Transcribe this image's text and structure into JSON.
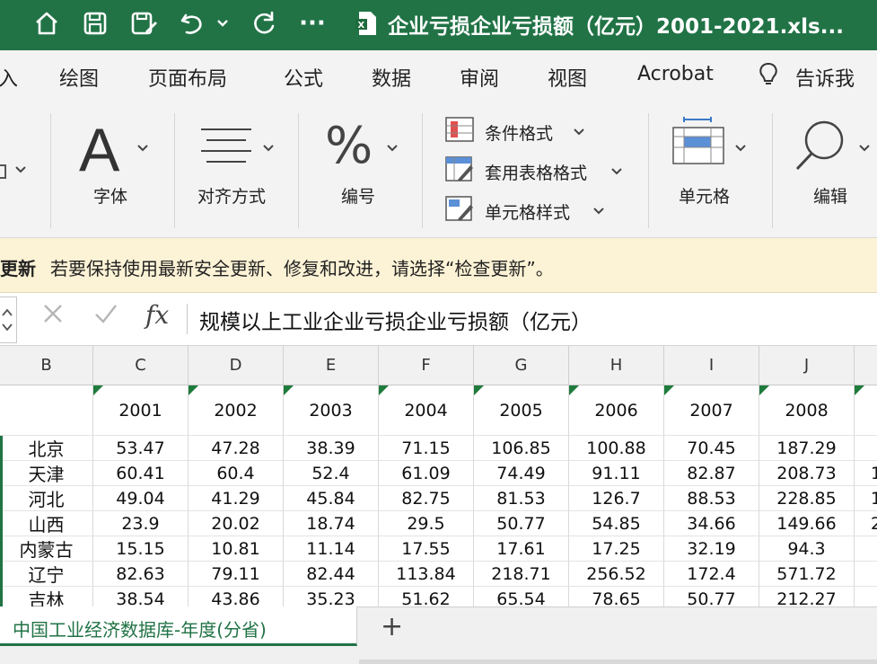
{
  "titlebar": {
    "title": "企业亏损企业亏损额（亿元）2001-2021.xls...",
    "icons": [
      "home-icon",
      "save-icon",
      "save-as-icon",
      "undo-icon",
      "chevron-down-icon",
      "redo-icon",
      "more-icon",
      "excel-file-icon"
    ],
    "more": "···"
  },
  "tabs": [
    "入",
    "绘图",
    "页面布局",
    "公式",
    "数据",
    "审阅",
    "视图",
    "Acrobat",
    "告诉我"
  ],
  "ribbon": {
    "font_label": "字体",
    "align_label": "对齐方式",
    "number_label": "编号",
    "cond_format": "条件格式",
    "table_format": "套用表格格式",
    "cell_style": "单元格样式",
    "cells_label": "单元格",
    "edit_label": "编辑"
  },
  "message": {
    "bold": "更新",
    "text": "若要保持使用最新安全更新、修复和改进，请选择“检查更新”。"
  },
  "formula": {
    "fx": "fx",
    "value": "规模以上工业企业亏损企业亏损额（亿元）"
  },
  "columns": [
    "B",
    "C",
    "D",
    "E",
    "F",
    "G",
    "H",
    "I",
    "J"
  ],
  "years": [
    "2001",
    "2002",
    "2003",
    "2004",
    "2005",
    "2006",
    "2007",
    "2008"
  ],
  "rows": [
    {
      "name": "北京",
      "values": [
        "53.47",
        "47.28",
        "38.39",
        "71.15",
        "106.85",
        "100.88",
        "70.45",
        "187.29"
      ],
      "edge": ""
    },
    {
      "name": "天津",
      "values": [
        "60.41",
        "60.4",
        "52.4",
        "61.09",
        "74.49",
        "91.11",
        "82.87",
        "208.73"
      ],
      "edge": "1"
    },
    {
      "name": "河北",
      "values": [
        "49.04",
        "41.29",
        "45.84",
        "82.75",
        "81.53",
        "126.7",
        "88.53",
        "228.85"
      ],
      "edge": "1"
    },
    {
      "name": "山西",
      "values": [
        "23.9",
        "20.02",
        "18.74",
        "29.5",
        "50.77",
        "54.85",
        "34.66",
        "149.66"
      ],
      "edge": "2"
    },
    {
      "name": "内蒙古",
      "values": [
        "15.15",
        "10.81",
        "11.14",
        "17.55",
        "17.61",
        "17.25",
        "32.19",
        "94.3"
      ],
      "edge": ""
    },
    {
      "name": "辽宁",
      "values": [
        "82.63",
        "79.11",
        "82.44",
        "113.84",
        "218.71",
        "256.52",
        "172.4",
        "571.72"
      ],
      "edge": ""
    },
    {
      "name": "吉林",
      "values": [
        "38.54",
        "43.86",
        "35.23",
        "51.62",
        "65.54",
        "78.65",
        "50.77",
        "212.27"
      ],
      "edge": ""
    }
  ],
  "sheet": {
    "name": "中国工业经济数据库-年度(分省)",
    "add": "+"
  },
  "colors": {
    "accent": "#217346",
    "message_bg": "#fcf2d5",
    "ribbon_bg": "#f3f3f3"
  }
}
